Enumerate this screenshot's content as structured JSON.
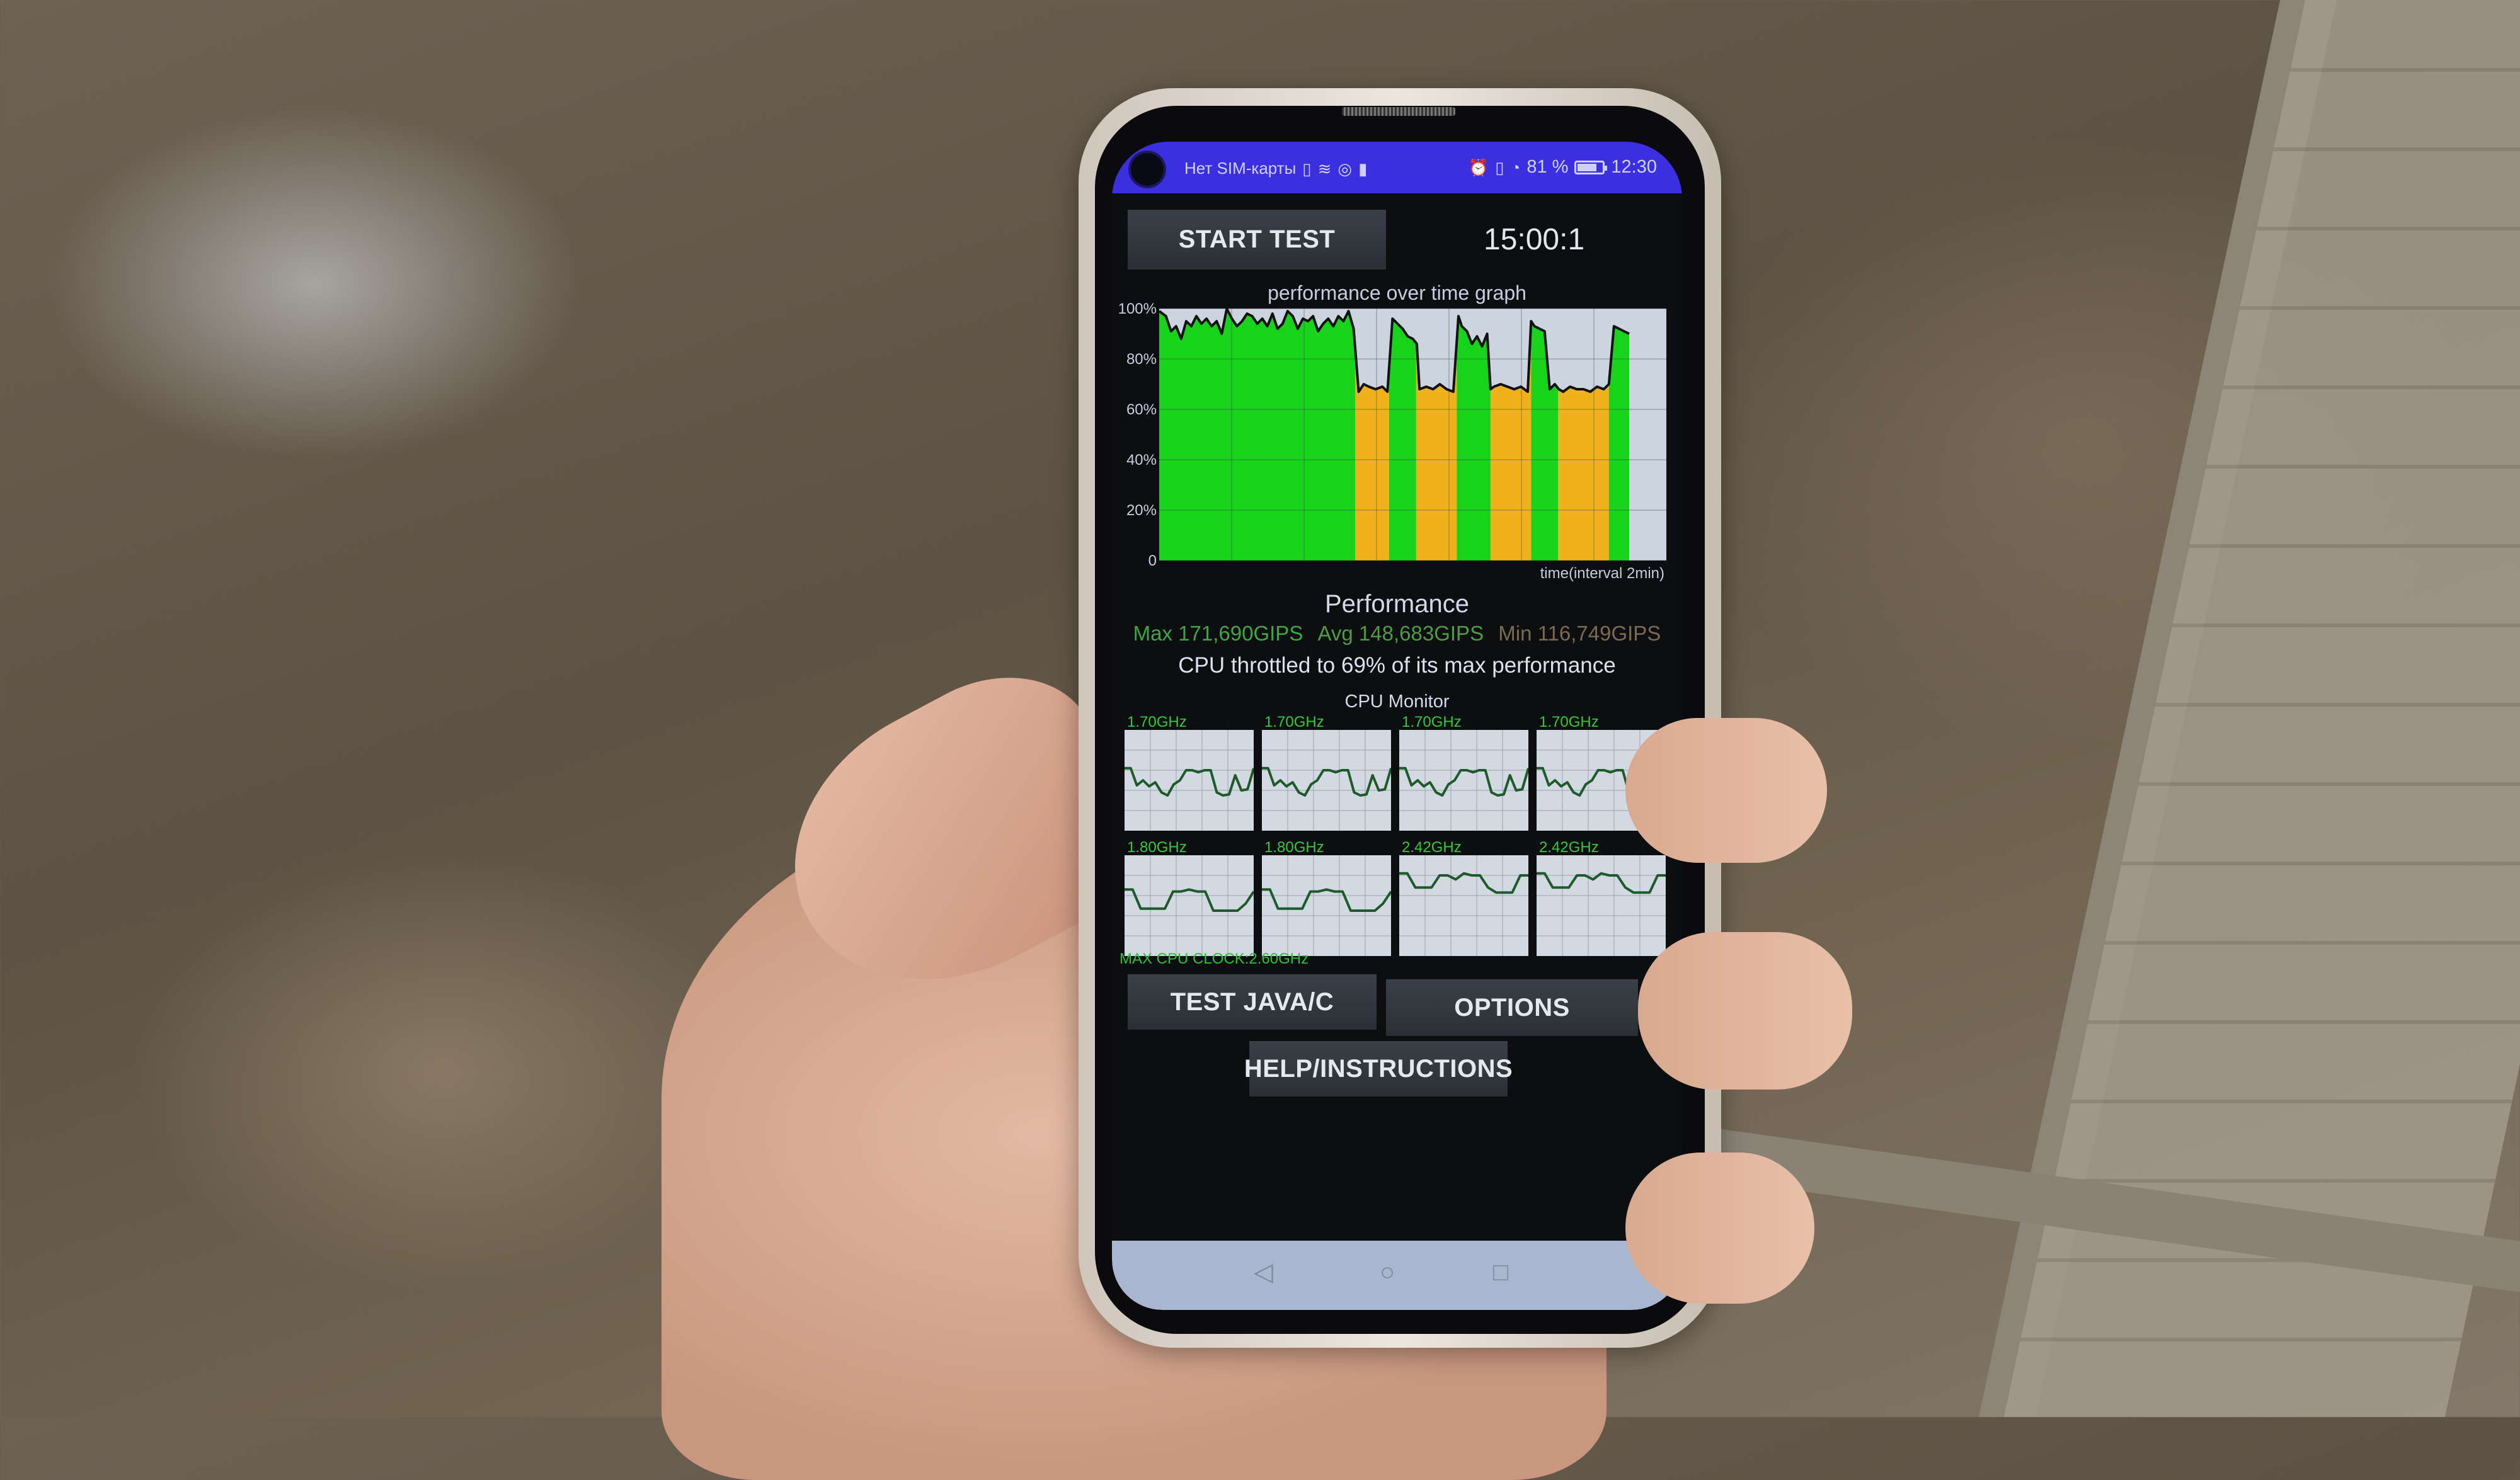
{
  "status_bar": {
    "carrier": "Нет SIM-карты",
    "left_icons": [
      "sim-icon",
      "wifi-icon",
      "instagram-icon",
      "battery-small-icon"
    ],
    "right_icons": [
      "alarm-icon",
      "vibrate-icon",
      "data-saver-icon"
    ],
    "battery_percent_label": "81 %",
    "battery_level": 0.81,
    "time": "12:30",
    "background_color": "#3b2fe0"
  },
  "header": {
    "start_test_label": "START TEST",
    "timer": "15:00:1"
  },
  "chart_data": {
    "type": "area",
    "title": "performance over time graph",
    "xlabel": "time(interval 2min)",
    "ylabel": "",
    "yticks": [
      "0",
      "20%",
      "40%",
      "60%",
      "80%",
      "100%"
    ],
    "ylim": [
      0,
      100
    ],
    "xlim": [
      0,
      15
    ],
    "grid": true,
    "colors": {
      "unthrottled": "#17d41b",
      "throttled": "#f0b21c",
      "background": "#ccd4e0",
      "line": "#111111"
    },
    "segments": [
      {
        "start": 0.0,
        "end": 5.8,
        "state": "unthrottled"
      },
      {
        "start": 5.8,
        "end": 6.8,
        "state": "throttled"
      },
      {
        "start": 6.8,
        "end": 7.6,
        "state": "unthrottled"
      },
      {
        "start": 7.6,
        "end": 8.8,
        "state": "throttled"
      },
      {
        "start": 8.8,
        "end": 9.8,
        "state": "unthrottled"
      },
      {
        "start": 9.8,
        "end": 11.0,
        "state": "throttled"
      },
      {
        "start": 11.0,
        "end": 11.8,
        "state": "unthrottled"
      },
      {
        "start": 11.8,
        "end": 13.3,
        "state": "throttled"
      },
      {
        "start": 13.3,
        "end": 13.9,
        "state": "unthrottled"
      }
    ],
    "series": [
      {
        "name": "performance",
        "x": [
          0.0,
          0.2,
          0.35,
          0.5,
          0.65,
          0.8,
          0.95,
          1.1,
          1.25,
          1.4,
          1.55,
          1.7,
          1.85,
          2.0,
          2.15,
          2.3,
          2.45,
          2.6,
          2.75,
          2.9,
          3.05,
          3.2,
          3.35,
          3.5,
          3.65,
          3.8,
          3.95,
          4.1,
          4.25,
          4.4,
          4.55,
          4.7,
          4.85,
          5.0,
          5.15,
          5.3,
          5.45,
          5.6,
          5.75,
          5.9,
          6.05,
          6.2,
          6.4,
          6.6,
          6.75,
          6.9,
          7.05,
          7.2,
          7.35,
          7.5,
          7.62,
          7.7,
          7.9,
          8.1,
          8.3,
          8.5,
          8.7,
          8.85,
          8.95,
          9.1,
          9.25,
          9.4,
          9.55,
          9.7,
          9.8,
          9.9,
          10.1,
          10.3,
          10.5,
          10.7,
          10.9,
          11.0,
          11.1,
          11.25,
          11.4,
          11.55,
          11.7,
          11.82,
          11.95,
          12.15,
          12.35,
          12.55,
          12.75,
          12.95,
          13.15,
          13.3,
          13.45,
          13.6,
          13.75,
          13.9
        ],
        "values": [
          99,
          97,
          91,
          93,
          88,
          95,
          93,
          97,
          94,
          96,
          93,
          95,
          90,
          100,
          96,
          93,
          95,
          98,
          97,
          94,
          96,
          93,
          98,
          92,
          94,
          99,
          97,
          92,
          96,
          95,
          97,
          91,
          94,
          96,
          93,
          97,
          95,
          99,
          92,
          67,
          70,
          69,
          68,
          69,
          67,
          96,
          94,
          92,
          89,
          88,
          86,
          68,
          69,
          68,
          70,
          68,
          67,
          97,
          93,
          91,
          86,
          89,
          85,
          90,
          68,
          69,
          70,
          69,
          68,
          69,
          67,
          95,
          93,
          92,
          91,
          68,
          70,
          68,
          67,
          69,
          68,
          68,
          67,
          69,
          68,
          70,
          93,
          92,
          91,
          90
        ]
      }
    ],
    "performance_summary": {
      "title": "Performance",
      "max_label": "Max 171,690GIPS",
      "avg_label": "Avg 148,683GIPS",
      "min_label": "Min 116,749GIPS",
      "max_gips": 171690,
      "avg_gips": 148683,
      "min_gips": 116749,
      "throttle_text": "CPU throttled to 69% of its max performance",
      "throttle_percent": 69
    }
  },
  "cpu_monitor": {
    "title": "CPU Monitor",
    "max_clock_label": "MAX CPU CLOCK:2.60GHz",
    "line_color": "#1e5a2a",
    "cores": [
      {
        "freq": "1.70GHz",
        "trace": [
          0.62,
          0.62,
          0.45,
          0.5,
          0.44,
          0.48,
          0.38,
          0.35,
          0.46,
          0.5,
          0.6,
          0.6,
          0.58,
          0.6,
          0.6,
          0.38,
          0.35,
          0.36,
          0.55,
          0.4,
          0.41,
          0.62
        ]
      },
      {
        "freq": "1.70GHz",
        "trace": [
          0.62,
          0.62,
          0.45,
          0.5,
          0.44,
          0.48,
          0.38,
          0.35,
          0.46,
          0.5,
          0.6,
          0.6,
          0.58,
          0.6,
          0.6,
          0.38,
          0.35,
          0.36,
          0.55,
          0.4,
          0.41,
          0.62
        ]
      },
      {
        "freq": "1.70GHz",
        "trace": [
          0.62,
          0.62,
          0.45,
          0.5,
          0.44,
          0.48,
          0.38,
          0.35,
          0.46,
          0.5,
          0.6,
          0.6,
          0.58,
          0.6,
          0.6,
          0.38,
          0.35,
          0.36,
          0.55,
          0.4,
          0.41,
          0.62
        ]
      },
      {
        "freq": "1.70GHz",
        "trace": [
          0.62,
          0.62,
          0.45,
          0.5,
          0.44,
          0.48,
          0.38,
          0.35,
          0.46,
          0.5,
          0.6,
          0.6,
          0.58,
          0.6,
          0.6,
          0.38,
          0.35,
          0.36,
          0.55,
          0.4,
          0.41,
          0.62
        ]
      },
      {
        "freq": "1.80GHz",
        "trace": [
          0.66,
          0.66,
          0.47,
          0.47,
          0.47,
          0.47,
          0.64,
          0.64,
          0.66,
          0.64,
          0.64,
          0.45,
          0.45,
          0.45,
          0.45,
          0.52,
          0.64
        ]
      },
      {
        "freq": "1.80GHz",
        "trace": [
          0.66,
          0.66,
          0.47,
          0.47,
          0.47,
          0.47,
          0.64,
          0.64,
          0.66,
          0.64,
          0.64,
          0.45,
          0.45,
          0.45,
          0.45,
          0.52,
          0.64
        ]
      },
      {
        "freq": "2.42GHz",
        "trace": [
          0.82,
          0.82,
          0.68,
          0.68,
          0.68,
          0.8,
          0.8,
          0.76,
          0.82,
          0.8,
          0.8,
          0.68,
          0.63,
          0.63,
          0.63,
          0.8,
          0.8
        ]
      },
      {
        "freq": "2.42GHz",
        "trace": [
          0.82,
          0.82,
          0.68,
          0.68,
          0.68,
          0.8,
          0.8,
          0.76,
          0.82,
          0.8,
          0.8,
          0.68,
          0.63,
          0.63,
          0.63,
          0.8,
          0.8
        ]
      }
    ]
  },
  "buttons": {
    "test_java_c": "TEST JAVA/C",
    "options": "OPTIONS",
    "help": "HELP/INSTRUCTIONS"
  },
  "nav_bar": {
    "back": "◁",
    "home": "○",
    "recents": "□"
  }
}
